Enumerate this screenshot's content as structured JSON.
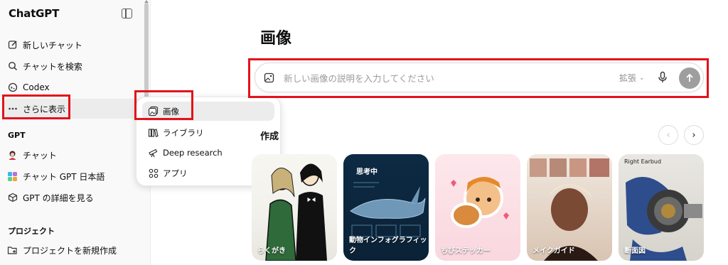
{
  "sidebar": {
    "brand": "ChatGPT",
    "items": [
      {
        "label": "新しいチャット",
        "icon": "edit-icon"
      },
      {
        "label": "チャットを検索",
        "icon": "search-icon"
      },
      {
        "label": "Codex",
        "icon": "codex-icon"
      },
      {
        "label": "さらに表示",
        "icon": "more-dots-icon"
      }
    ],
    "gpt_section": {
      "title": "GPT",
      "items": [
        {
          "label": "チャット",
          "icon": "gpt-avatar-icon"
        },
        {
          "label": "チャット GPT 日本語",
          "icon": "gpt-colorful-icon"
        },
        {
          "label": "GPT の詳細を見る",
          "icon": "cube-icon"
        }
      ]
    },
    "project_section": {
      "title": "プロジェクト",
      "items": [
        {
          "label": "プロジェクトを新規作成",
          "icon": "folder-plus-icon"
        }
      ]
    }
  },
  "popup_menu": {
    "items": [
      {
        "label": "画像",
        "icon": "images-icon"
      },
      {
        "label": "ライブラリ",
        "icon": "library-icon"
      },
      {
        "label": "Deep research",
        "icon": "telescope-icon"
      },
      {
        "label": "アプリ",
        "icon": "apps-grid-icon"
      }
    ]
  },
  "main": {
    "title": "画像",
    "prompt": {
      "placeholder": "新しい画像の説明を入力してください",
      "value": "",
      "expand_label": "拡張"
    },
    "create_heading": "作成",
    "cards": [
      {
        "label": "らくがき",
        "top_label": ""
      },
      {
        "label": "動物インフォグラフィック",
        "top_label": "思考中"
      },
      {
        "label": "ちびステッカー",
        "top_label": ""
      },
      {
        "label": "メイクガイド",
        "top_label": ""
      },
      {
        "label": "断面図",
        "top_label": "Right Earbud"
      }
    ]
  },
  "colors": {
    "highlight_box": "#e3121b",
    "sidebar_bg": "#f9f9f9",
    "send_button": "#9e9e9e"
  }
}
